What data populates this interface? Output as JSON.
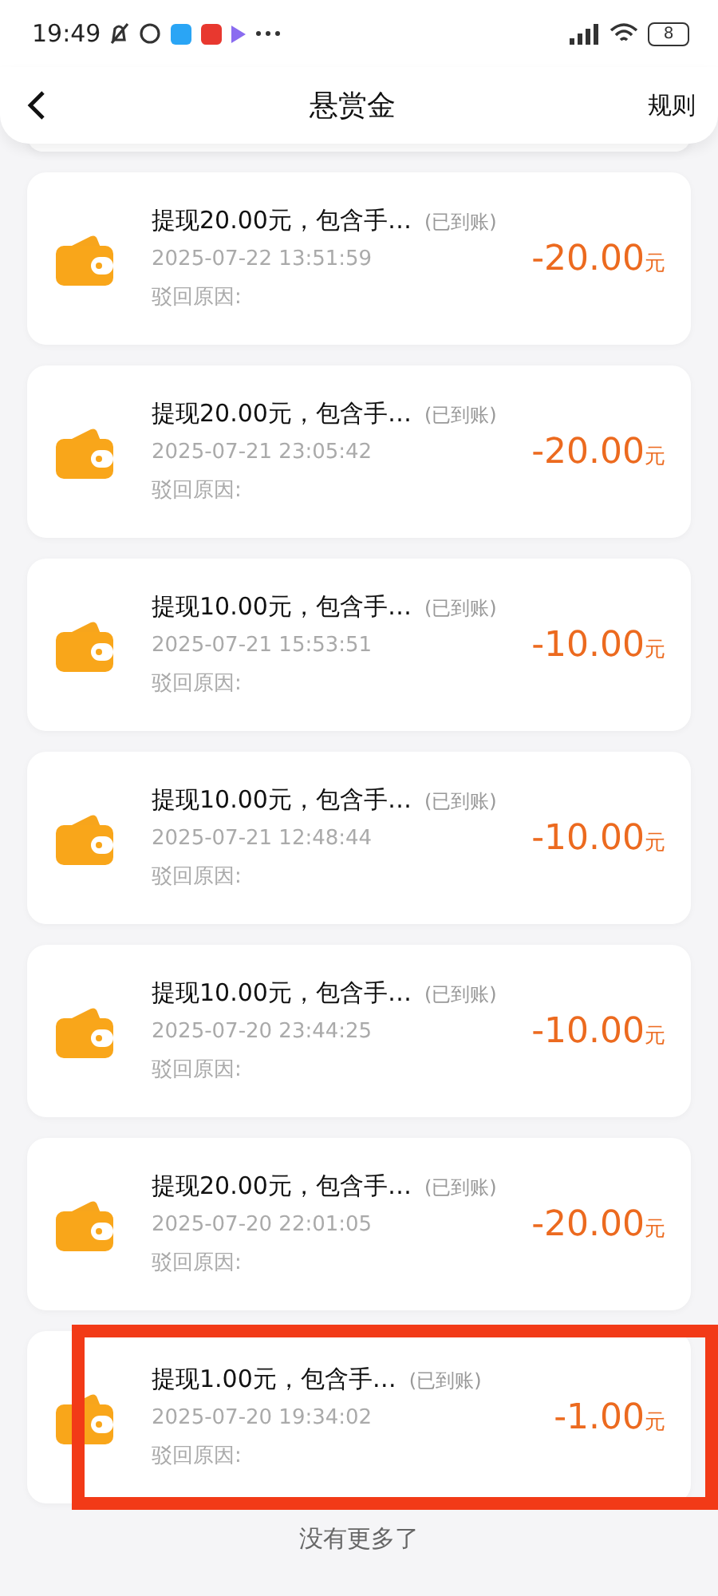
{
  "status_bar": {
    "time": "19:49",
    "battery": "8"
  },
  "header": {
    "title": "悬赏金",
    "action": "规则"
  },
  "records": [
    {
      "title": "提现20.00元，包含手…",
      "status": "(已到账)",
      "date": "2025-07-22 13:51:59",
      "reason_label": "驳回原因:",
      "amount": "-20.00",
      "unit": "元",
      "highlighted": false
    },
    {
      "title": "提现20.00元，包含手…",
      "status": "(已到账)",
      "date": "2025-07-21 23:05:42",
      "reason_label": "驳回原因:",
      "amount": "-20.00",
      "unit": "元",
      "highlighted": false
    },
    {
      "title": "提现10.00元，包含手…",
      "status": "(已到账)",
      "date": "2025-07-21 15:53:51",
      "reason_label": "驳回原因:",
      "amount": "-10.00",
      "unit": "元",
      "highlighted": false
    },
    {
      "title": "提现10.00元，包含手…",
      "status": "(已到账)",
      "date": "2025-07-21 12:48:44",
      "reason_label": "驳回原因:",
      "amount": "-10.00",
      "unit": "元",
      "highlighted": false
    },
    {
      "title": "提现10.00元，包含手…",
      "status": "(已到账)",
      "date": "2025-07-20 23:44:25",
      "reason_label": "驳回原因:",
      "amount": "-10.00",
      "unit": "元",
      "highlighted": false
    },
    {
      "title": "提现20.00元，包含手…",
      "status": "(已到账)",
      "date": "2025-07-20 22:01:05",
      "reason_label": "驳回原因:",
      "amount": "-20.00",
      "unit": "元",
      "highlighted": false
    },
    {
      "title": "提现1.00元，包含手…",
      "status": "(已到账)",
      "date": "2025-07-20 19:34:02",
      "reason_label": "驳回原因:",
      "amount": "-1.00",
      "unit": "元",
      "highlighted": true
    }
  ],
  "footer": "没有更多了"
}
